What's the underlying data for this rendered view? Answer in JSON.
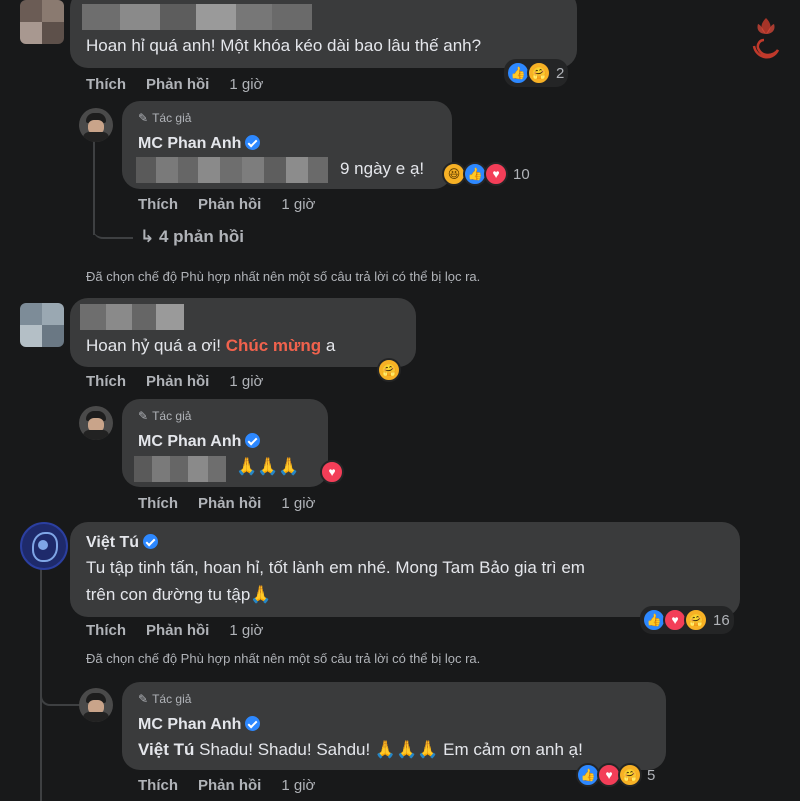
{
  "comments": [
    {
      "text": "Hoan hỉ quá anh! Một khóa kéo dài bao lâu thế anh?",
      "actions": {
        "like": "Thích",
        "reply": "Phản hồi",
        "time": "1 giờ"
      },
      "reaction_count": "2"
    },
    {
      "author_tag": "Tác giả",
      "name": "MC Phan Anh",
      "text_suffix": "9 ngày e ạ!",
      "actions": {
        "like": "Thích",
        "reply": "Phản hồi",
        "time": "1 giờ"
      },
      "reaction_count": "10",
      "replies_link": "4 phản hồi"
    },
    {
      "filter_note": "Đã chọn chế độ Phù hợp nhất nên một số câu trả lời có thể bị lọc ra."
    },
    {
      "text_prefix": "Hoan hỷ quá a ơi!",
      "text_highlight": "Chúc mừng",
      "text_suffix": "a",
      "actions": {
        "like": "Thích",
        "reply": "Phản hồi",
        "time": "1 giờ"
      }
    },
    {
      "author_tag": "Tác giả",
      "name": "MC Phan Anh",
      "text_suffix": "🙏🙏🙏",
      "actions": {
        "like": "Thích",
        "reply": "Phản hồi",
        "time": "1 giờ"
      }
    },
    {
      "name": "Việt Tú",
      "text_line1": "Tu tập tinh tấn, hoan hỉ, tốt lành em nhé. Mong Tam Bảo gia trì em",
      "text_line2": "trên con đường tu tập🙏",
      "actions": {
        "like": "Thích",
        "reply": "Phản hồi",
        "time": "1 giờ"
      },
      "reaction_count": "16",
      "filter_note": "Đã chọn chế độ Phù hợp nhất nên một số câu trả lời có thể bị lọc ra."
    },
    {
      "author_tag": "Tác giả",
      "name": "MC Phan Anh",
      "mention": "Việt Tú",
      "text": "Shadu! Shadu! Sahdu! 🙏🙏🙏 Em cảm ơn anh ạ!",
      "actions": {
        "like": "Thích",
        "reply": "Phản hồi",
        "time": "1 giờ"
      },
      "reaction_count": "5"
    }
  ],
  "colors": {
    "background": "#18191a",
    "bubble": "#3a3b3c",
    "verified": "#2d88ff",
    "highlight": "#f0624d",
    "like": "#2d88ff",
    "love": "#f33e58",
    "care": "#f7b125"
  },
  "icons": [
    "pencil-icon",
    "verified-badge-icon",
    "reply-arrow-icon",
    "like-reaction-icon",
    "love-reaction-icon",
    "care-reaction-icon",
    "haha-reaction-icon",
    "watermark-logo"
  ]
}
